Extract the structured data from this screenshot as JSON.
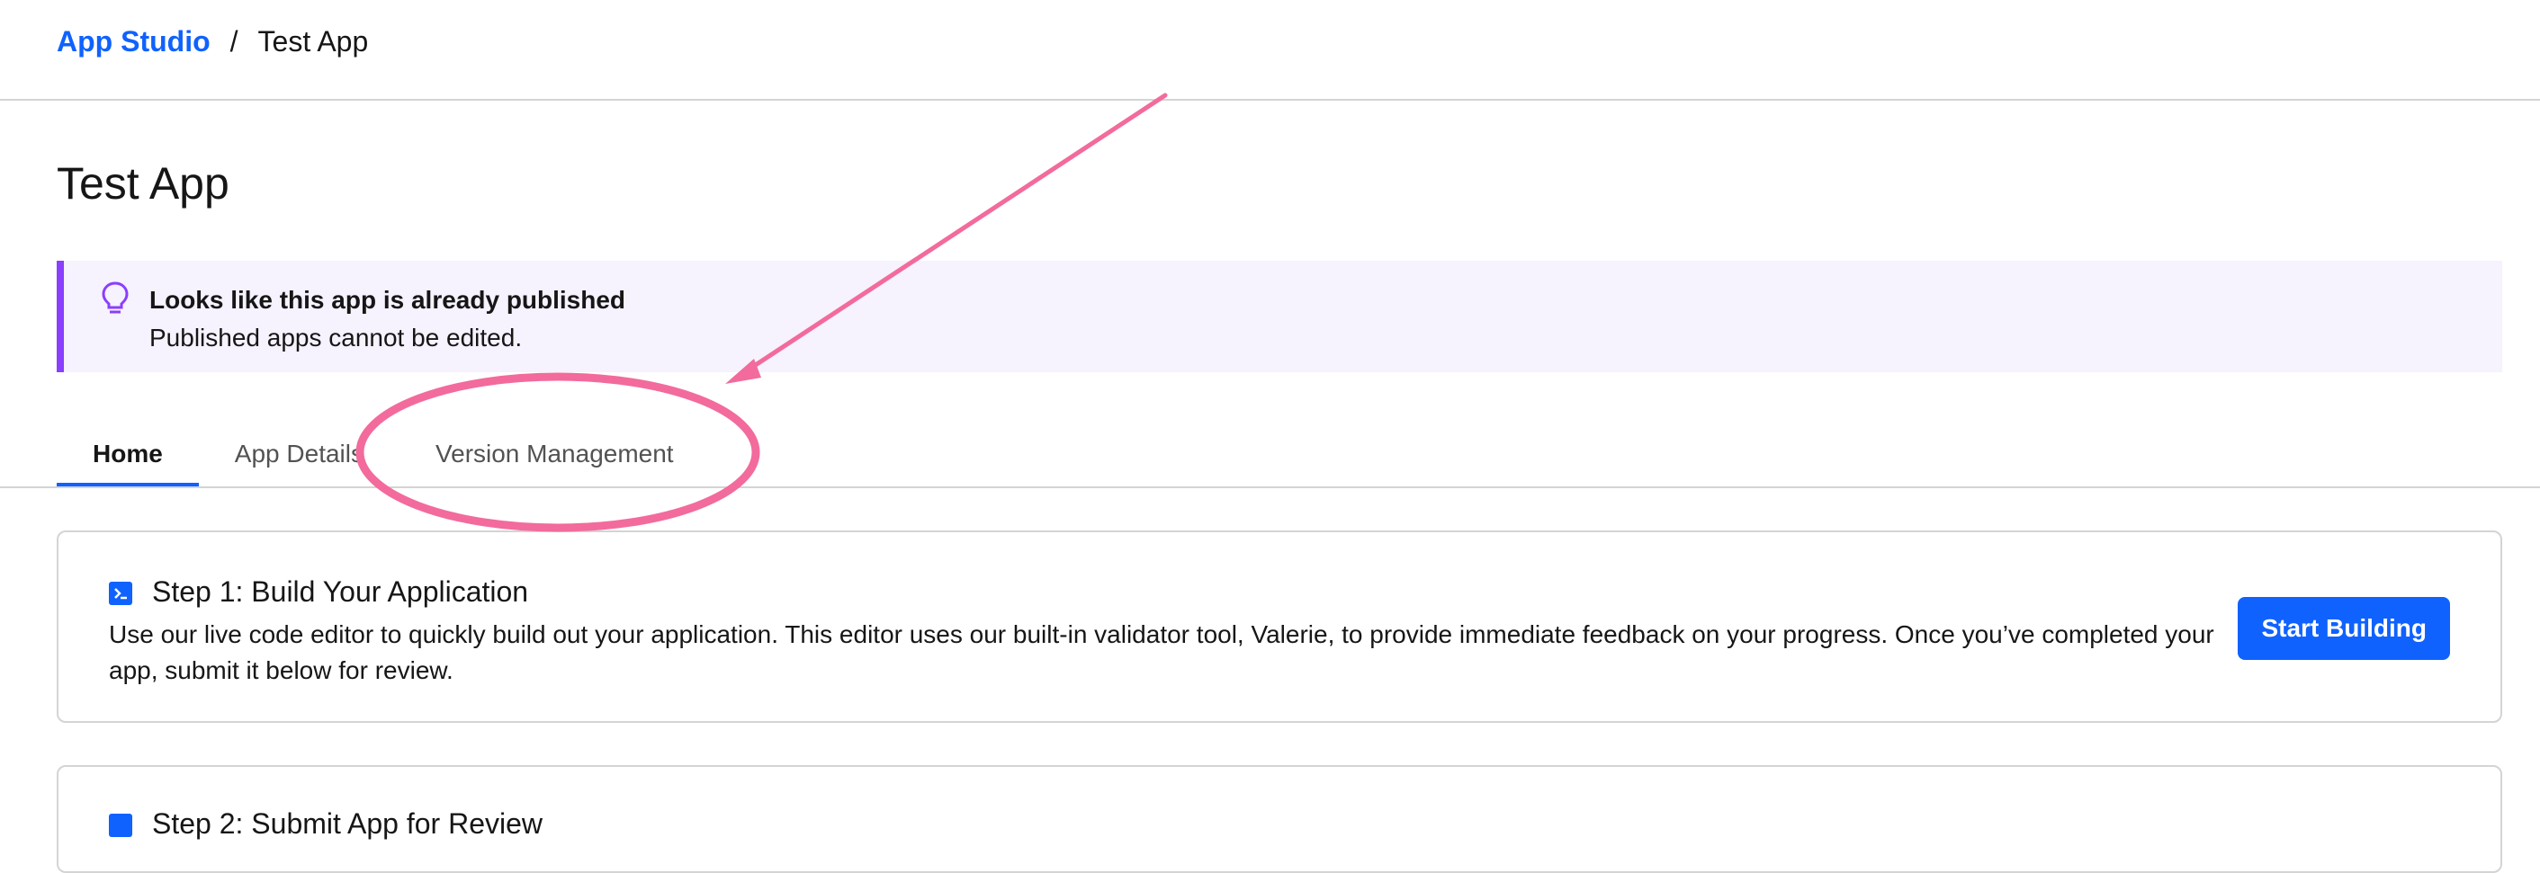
{
  "breadcrumb": {
    "root": "App Studio",
    "separator": "/",
    "current": "Test App"
  },
  "page_title": "Test App",
  "banner": {
    "icon": "lightbulb-icon",
    "title": "Looks like this app is already published",
    "text": "Published apps cannot be edited."
  },
  "tabs": [
    {
      "label": "Home",
      "active": true
    },
    {
      "label": "App Details",
      "active": false
    },
    {
      "label": "Version Management",
      "active": false
    }
  ],
  "steps": [
    {
      "icon": "terminal-icon",
      "title": "Step 1: Build Your Application",
      "description": "Use our live code editor to quickly build out your application. This editor uses our built-in validator tool, Valerie, to provide immediate feedback on your progress. Once you’ve completed your app, submit it below for review.",
      "button_label": "Start Building"
    },
    {
      "icon": "upload-icon",
      "title": "Step 2: Submit App for Review"
    }
  ],
  "colors": {
    "brand_blue": "#0f62fe",
    "banner_accent": "#8a3ffc",
    "banner_bg": "#f6f2fe",
    "annotation_pink": "#f26b9c"
  }
}
